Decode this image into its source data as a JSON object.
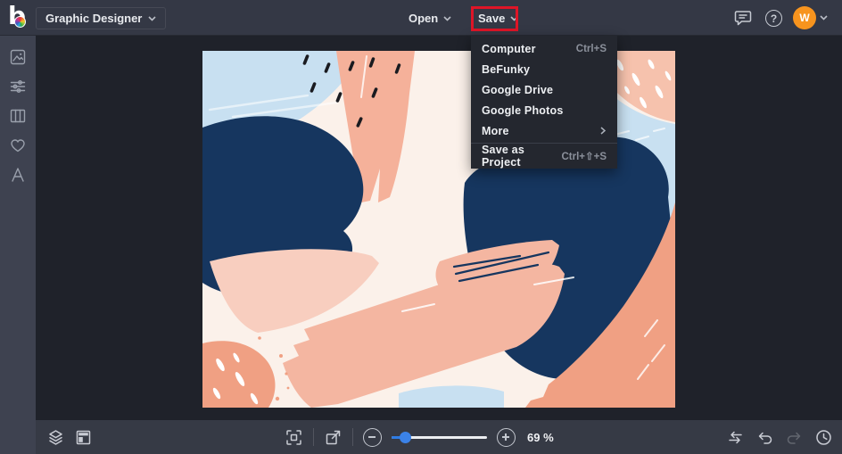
{
  "topbar": {
    "logo_letter": "b",
    "mode_label": "Graphic Designer",
    "open_label": "Open",
    "save_label": "Save",
    "help_glyph": "?",
    "avatar_initial": "W"
  },
  "save_menu": {
    "items": [
      {
        "label": "Computer",
        "shortcut": "Ctrl+S"
      },
      {
        "label": "BeFunky",
        "shortcut": ""
      },
      {
        "label": "Google Drive",
        "shortcut": ""
      },
      {
        "label": "Google Photos",
        "shortcut": ""
      },
      {
        "label": "More",
        "shortcut": ""
      },
      {
        "label": "Save as Project",
        "shortcut": "Ctrl+⇧+S"
      }
    ]
  },
  "sidebar": {
    "icons": [
      "image",
      "adjustments",
      "layout-columns",
      "heart",
      "text"
    ]
  },
  "bottombar": {
    "zoom_percent": "69 %"
  },
  "colors": {
    "annotation_red": "#de1527",
    "accent_blue": "#2e7ce4",
    "avatar_orange": "#f7941e",
    "canvas_palette": [
      "#fbf1ea",
      "#c8e0f1",
      "#f5b19a",
      "#f0a083",
      "#16365f",
      "#1a1b20",
      "#ffffff"
    ]
  }
}
